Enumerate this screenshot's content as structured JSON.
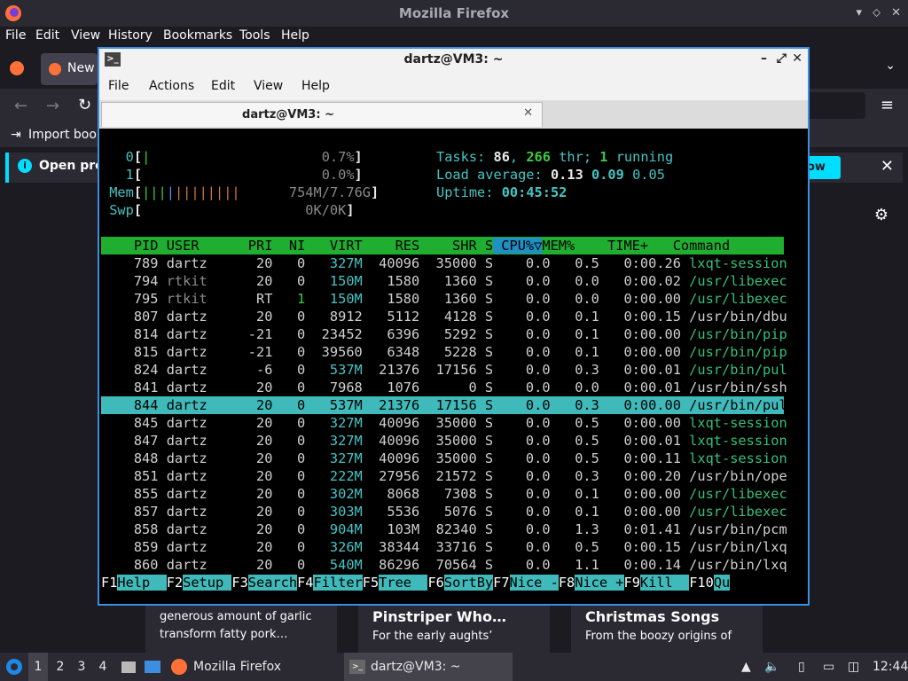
{
  "firefox": {
    "title": "Mozilla Firefox",
    "menu": [
      "File",
      "Edit",
      "View",
      "History",
      "Bookmarks",
      "Tools",
      "Help"
    ],
    "tab_label": "New",
    "bookmark_label": "Import book",
    "notice_label": "Open pre",
    "notice_btn": "ow",
    "cards": [
      {
        "line1": "generous amount of garlic",
        "line2": "transform fatty pork…"
      },
      {
        "title": "Pinstriper Who…",
        "line2": "For the early aughts’"
      },
      {
        "title": "Christmas Songs",
        "line2": "From the boozy origins of"
      }
    ]
  },
  "terminal": {
    "title": "dartz@VM3: ~",
    "menu": [
      "File",
      "Actions",
      "Edit",
      "View",
      "Help"
    ],
    "tab_title": "dartz@VM3: ~"
  },
  "htop": {
    "cpu0": {
      "label": "0",
      "bar": "|",
      "pct": "0.7%"
    },
    "cpu1": {
      "label": "1",
      "bar": "",
      "pct": "0.0%"
    },
    "mem": {
      "label": "Mem",
      "bar": "||||||||||||",
      "val": "754M/7.76G"
    },
    "swp": {
      "label": "Swp",
      "bar": "",
      "val": "0K/0K"
    },
    "tasks": {
      "label": "Tasks:",
      "count": "86",
      "thr": "266",
      "thr_label": "thr;",
      "running": "1",
      "running_label": "running"
    },
    "load": {
      "label": "Load average:",
      "l1": "0.13",
      "l5": "0.09",
      "l15": "0.05"
    },
    "uptime": {
      "label": "Uptime:",
      "value": "00:45:52"
    },
    "columns": [
      "PID",
      "USER",
      "PRI",
      "NI",
      "VIRT",
      "RES",
      "SHR",
      "S",
      "CPU%▽",
      "MEM%",
      "TIME+",
      "Command"
    ],
    "rows": [
      [
        "789",
        "dartz",
        "20",
        "0",
        "327M",
        "40096",
        "35000",
        "S",
        "0.0",
        "0.5",
        "0:00.26",
        "lxqt-session"
      ],
      [
        "794",
        "rtkit",
        "20",
        "0",
        "150M",
        "1580",
        "1360",
        "S",
        "0.0",
        "0.0",
        "0:00.02",
        "/usr/libexec"
      ],
      [
        "795",
        "rtkit",
        "RT",
        "1",
        "150M",
        "1580",
        "1360",
        "S",
        "0.0",
        "0.0",
        "0:00.00",
        "/usr/libexec"
      ],
      [
        "807",
        "dartz",
        "20",
        "0",
        "8912",
        "5112",
        "4128",
        "S",
        "0.0",
        "0.1",
        "0:00.15",
        "/usr/bin/dbu"
      ],
      [
        "814",
        "dartz",
        "-21",
        "0",
        "23452",
        "6396",
        "5292",
        "S",
        "0.0",
        "0.1",
        "0:00.00",
        "/usr/bin/pip"
      ],
      [
        "815",
        "dartz",
        "-21",
        "0",
        "39560",
        "6348",
        "5228",
        "S",
        "0.0",
        "0.1",
        "0:00.00",
        "/usr/bin/pip"
      ],
      [
        "824",
        "dartz",
        "-6",
        "0",
        "537M",
        "21376",
        "17156",
        "S",
        "0.0",
        "0.3",
        "0:00.01",
        "/usr/bin/pul"
      ],
      [
        "841",
        "dartz",
        "20",
        "0",
        "7968",
        "1076",
        "0",
        "S",
        "0.0",
        "0.0",
        "0:00.01",
        "/usr/bin/ssh"
      ],
      [
        "844",
        "dartz",
        "20",
        "0",
        "537M",
        "21376",
        "17156",
        "S",
        "0.0",
        "0.3",
        "0:00.00",
        "/usr/bin/pul"
      ],
      [
        "845",
        "dartz",
        "20",
        "0",
        "327M",
        "40096",
        "35000",
        "S",
        "0.0",
        "0.5",
        "0:00.00",
        "lxqt-session"
      ],
      [
        "847",
        "dartz",
        "20",
        "0",
        "327M",
        "40096",
        "35000",
        "S",
        "0.0",
        "0.5",
        "0:00.01",
        "lxqt-session"
      ],
      [
        "848",
        "dartz",
        "20",
        "0",
        "327M",
        "40096",
        "35000",
        "S",
        "0.0",
        "0.5",
        "0:00.11",
        "lxqt-session"
      ],
      [
        "851",
        "dartz",
        "20",
        "0",
        "222M",
        "27956",
        "21572",
        "S",
        "0.0",
        "0.3",
        "0:00.20",
        "/usr/bin/ope"
      ],
      [
        "855",
        "dartz",
        "20",
        "0",
        "302M",
        "8068",
        "7308",
        "S",
        "0.0",
        "0.1",
        "0:00.00",
        "/usr/libexec"
      ],
      [
        "857",
        "dartz",
        "20",
        "0",
        "303M",
        "5536",
        "5076",
        "S",
        "0.0",
        "0.1",
        "0:00.00",
        "/usr/libexec"
      ],
      [
        "858",
        "dartz",
        "20",
        "0",
        "904M",
        "103M",
        "82340",
        "S",
        "0.0",
        "1.3",
        "0:01.41",
        "/usr/bin/pcm"
      ],
      [
        "859",
        "dartz",
        "20",
        "0",
        "326M",
        "38344",
        "33716",
        "S",
        "0.0",
        "0.5",
        "0:00.15",
        "/usr/bin/lxq"
      ],
      [
        "860",
        "dartz",
        "20",
        "0",
        "540M",
        "86296",
        "70564",
        "S",
        "0.0",
        "1.1",
        "0:00.14",
        "/usr/bin/lxq"
      ]
    ],
    "selected_index": 8,
    "fkeys": [
      [
        "F1",
        "Help  "
      ],
      [
        "F2",
        "Setup "
      ],
      [
        "F3",
        "Search"
      ],
      [
        "F4",
        "Filter"
      ],
      [
        "F5",
        "Tree  "
      ],
      [
        "F6",
        "SortBy"
      ],
      [
        "F7",
        "Nice -"
      ],
      [
        "F8",
        "Nice +"
      ],
      [
        "F9",
        "Kill  "
      ],
      [
        "F10",
        "Qu"
      ]
    ]
  },
  "taskbar": {
    "desktops": [
      "1",
      "2",
      "3",
      "4"
    ],
    "firefox_label": "Mozilla Firefox",
    "terminal_label": "dartz@VM3: ~",
    "clock": "12:44"
  }
}
